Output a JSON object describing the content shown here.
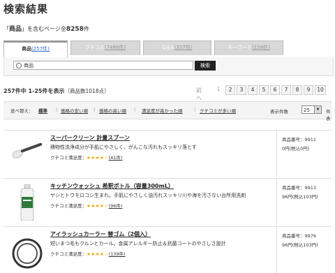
{
  "page_title": "検索結果",
  "subtitle": {
    "prefix": "「",
    "keyword": "商品",
    "middle": "」を含むページ全",
    "total": "8258",
    "suffix": "件"
  },
  "tabs": [
    {
      "label": "商品",
      "count": "(257件)"
    },
    {
      "label": "クチコミ",
      "count": "(7486件)"
    },
    {
      "label": "Q＆A",
      "count": "(357件)"
    },
    {
      "label": "キーワード",
      "count": "(158件)"
    }
  ],
  "search": {
    "value": "商品",
    "button": "検索"
  },
  "summary": {
    "main": "257件中 1-25件を表示",
    "sub": "（商品数1018点）"
  },
  "pager": {
    "prev": "前へ",
    "pages": [
      "1",
      "2",
      "3",
      "4",
      "5",
      "6",
      "7",
      "8",
      "9",
      "10"
    ],
    "current": "1"
  },
  "sort": {
    "label": "並べ替え：",
    "options": [
      "標準",
      "価格の安い順",
      "価格の高い順",
      "満足度が高かった順",
      "クチコミが多い順"
    ],
    "count_label": "表示件数",
    "count_value": "25",
    "count_suffix": "件表"
  },
  "items": [
    {
      "name": "スーパークリーン 計量スプーン",
      "desc": "積物性洗浄成分が手肌にやさしく、がんこな汚れもスッキリ落とす",
      "rating_label": "クチコミ満足度：",
      "stars": "★★★★☆",
      "reviews": "(41件)",
      "no": "商品番号：9911",
      "price": "0円(税込0円)"
    },
    {
      "name": "キッチンウォッシュ 希釈ボトル（容量300mL）",
      "desc": "ヤシとトウモロコシ生まれ。手肌にやさしく油汚れスッキリ川や海を汚さない台所用洗剤",
      "rating_label": "クチコミ満足度：",
      "stars": "★★★★☆",
      "reviews": "(96件)",
      "no": "商品番号：9913",
      "price": "96円(税込103円)"
    },
    {
      "name": "アイラッシュカーラー 替ゴム（2個入）",
      "desc": "短いまつ毛もクルンとカール。金属アレルギー防止＆抗菌コートのやさしさ設計",
      "rating_label": "クチコミ満足度：",
      "stars": "★★★★☆",
      "reviews": "(139件)",
      "no": "商品番号：9976",
      "price": "96円(税込103円)"
    }
  ],
  "colors": {
    "accent_link": "#3366cc",
    "star": "#e8a000",
    "button_bg": "#222222"
  }
}
